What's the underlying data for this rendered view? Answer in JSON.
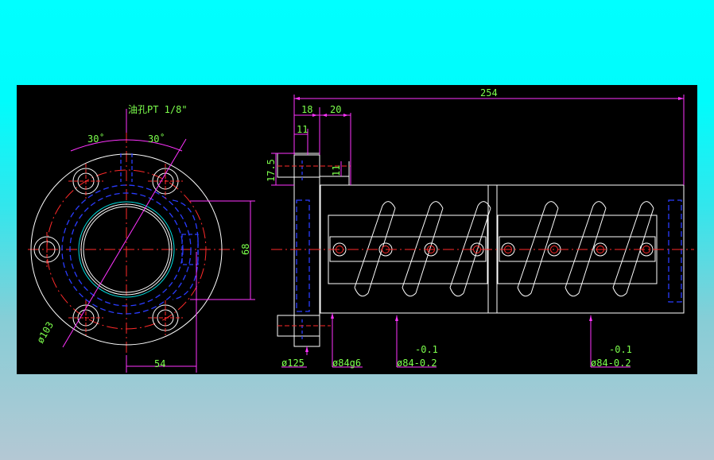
{
  "drawing": {
    "background_color": "#000000",
    "colors": {
      "outline": "#ffffff",
      "hidden": "#2a3cff",
      "center": "#ff2a2a",
      "dimension": "#ff33ff",
      "text": "#7cff4c",
      "bore_highlight": "#00e0e0"
    },
    "labels": {
      "oil_hole": "油孔PT 1/8\"",
      "angle_left": "30˚",
      "angle_right": "30˚",
      "dia_103": "ø103",
      "dim_54": "54",
      "dim_68": "68",
      "dim_254": "254",
      "dim_18": "18",
      "dim_20": "20",
      "dim_11_top": "11",
      "dim_17_5": "17.5",
      "dim_11_side": "11",
      "dia_125": "ø125",
      "dia_84g6": "ø84g6",
      "tol_upper_1": "-0.1",
      "dia_84_1": "ø84-0.2",
      "tol_upper_2": "-0.1",
      "dia_84_2": "ø84-0.2"
    }
  }
}
